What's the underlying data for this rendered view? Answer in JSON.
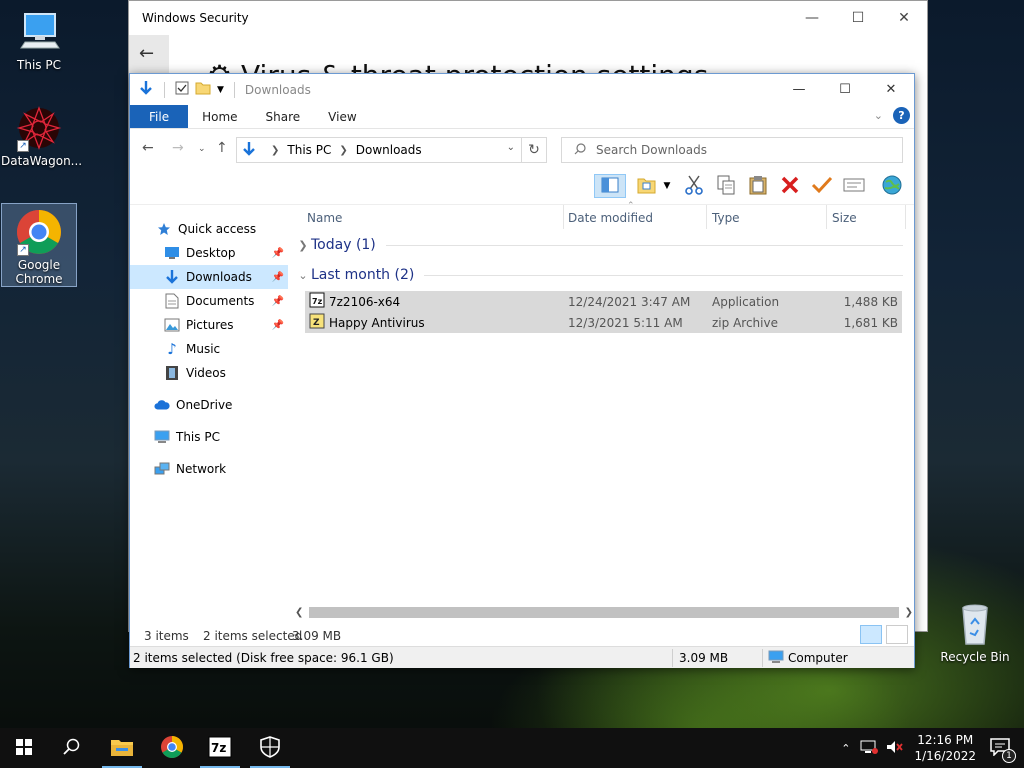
{
  "desktop": {
    "icons": [
      {
        "label": "This PC"
      },
      {
        "label": "DataWagon..."
      },
      {
        "label": "Google Chrome"
      },
      {
        "label": "Recycle Bin"
      }
    ]
  },
  "security_window": {
    "title": "Windows Security",
    "heading": "Virus & threat protection settings"
  },
  "explorer": {
    "title": "Downloads",
    "ribbon_tabs": [
      "File",
      "Home",
      "Share",
      "View"
    ],
    "address": {
      "crumbs": [
        "This PC",
        "Downloads"
      ]
    },
    "search_placeholder": "Search Downloads",
    "nav": {
      "quick_access": "Quick access",
      "items": [
        "Desktop",
        "Downloads",
        "Documents",
        "Pictures",
        "Music",
        "Videos"
      ],
      "onedrive": "OneDrive",
      "this_pc": "This PC",
      "network": "Network"
    },
    "columns": [
      "Name",
      "Date modified",
      "Type",
      "Size"
    ],
    "groups": [
      {
        "label": "Today (1)"
      },
      {
        "label": "Last month (2)"
      }
    ],
    "files": [
      {
        "name": "7z2106-x64",
        "date": "12/24/2021 3:47 AM",
        "type": "Application",
        "size": "1,488 KB"
      },
      {
        "name": "Happy Antivirus",
        "date": "12/3/2021 5:11 AM",
        "type": "zip Archive",
        "size": "1,681 KB"
      }
    ],
    "status": {
      "items": "3 items",
      "selected": "2 items selected",
      "size": "3.09 MB"
    },
    "details_bar": {
      "text": "2 items selected (Disk free space: 96.1 GB)",
      "size": "3.09 MB",
      "location": "Computer"
    }
  },
  "taskbar": {
    "clock_time": "12:16 PM",
    "clock_date": "1/16/2022",
    "notification_count": "1"
  },
  "colors": {
    "accent": "#1a63b8",
    "selection": "#cce8ff",
    "row_selected": "#d9d9d9",
    "group_text": "#1e3287"
  }
}
